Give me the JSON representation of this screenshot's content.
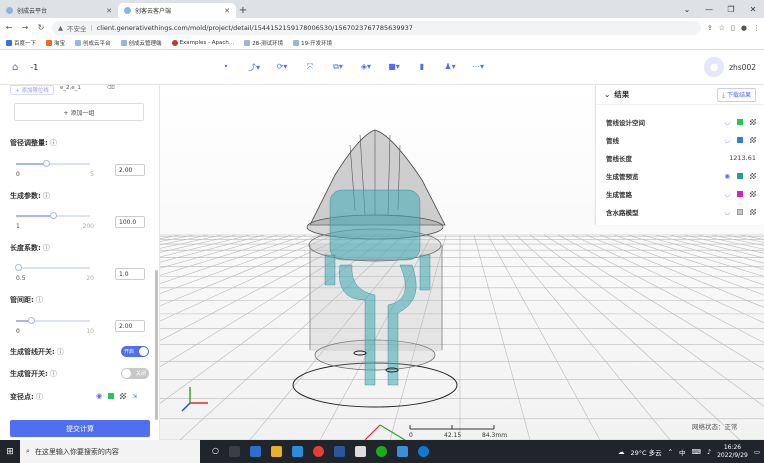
{
  "browser": {
    "tabs": [
      {
        "label": "创成云平台",
        "active": false
      },
      {
        "label": "创客云客户端",
        "active": true
      }
    ],
    "url_warning": "不安全",
    "url": "client.generativethings.com/mold/project/detail/15441521591780065​30/1567023767785639937",
    "bookmarks": [
      "百度一下",
      "淘宝",
      "创成云平台",
      "创成云管理端",
      "Examples - Apach...",
      "28-测试环境",
      "19-开发环境"
    ]
  },
  "app": {
    "project_name": "-1",
    "username": "zhs002",
    "toolbar_icons": [
      "dot-icon",
      "pipe-tool-icon",
      "rotate-tool-icon",
      "fit-icon",
      "box-tool-icon",
      "layer-tool-icon",
      "cube-tool-icon",
      "split-icon",
      "person-tool-icon",
      "more-icon"
    ]
  },
  "left_panel": {
    "chips": [
      "+ 添加限位线",
      "e_2,e_1"
    ],
    "add_group": "+ 添加一组",
    "pipe_diameter": {
      "label": "管径调整量:",
      "min": "0",
      "max": "5",
      "value": "2.00",
      "fraction": 0.4
    },
    "gen_params": {
      "label": "生成参数:",
      "min": "1",
      "max": "200",
      "value": "100.0",
      "fraction": 0.5
    },
    "length_coef": {
      "label": "长度系数:",
      "min": "0.5",
      "max": "20",
      "value": "1.0",
      "fraction": 0.03
    },
    "pipe_spacing": {
      "label": "管间距:",
      "min": "0",
      "max": "10",
      "value": "2.00",
      "fraction": 0.2
    },
    "switch_pipeline": {
      "label": "生成管线开关:",
      "state": "开启"
    },
    "switch_pipe": {
      "label": "生成管开关:",
      "state": "关闭"
    },
    "variable_points": {
      "label": "变径点:"
    },
    "submit_label": "提交计算"
  },
  "results": {
    "title": "结果",
    "download": "下载结果",
    "rows": [
      {
        "label": "管线设计空间",
        "color": "#22c55e"
      },
      {
        "label": "管线",
        "color": "#2f7fd8"
      },
      {
        "label": "管线长度",
        "value": "1213.61"
      },
      {
        "label": "生成管预览",
        "color": "#1f9e9e"
      },
      {
        "label": "生成管路",
        "color": "#d61fc4"
      },
      {
        "label": "含水路模型",
        "color": "#c7c7c7"
      }
    ]
  },
  "viewport": {
    "scale_labels": [
      "0",
      "42.15",
      "84.3mm"
    ],
    "network_status": "网络状态：正常"
  },
  "taskbar": {
    "search_placeholder": "在这里输入你要搜索的内容",
    "weather": "29°C 多云",
    "ime": "中",
    "time": "16:26",
    "date": "2022/9/29"
  }
}
